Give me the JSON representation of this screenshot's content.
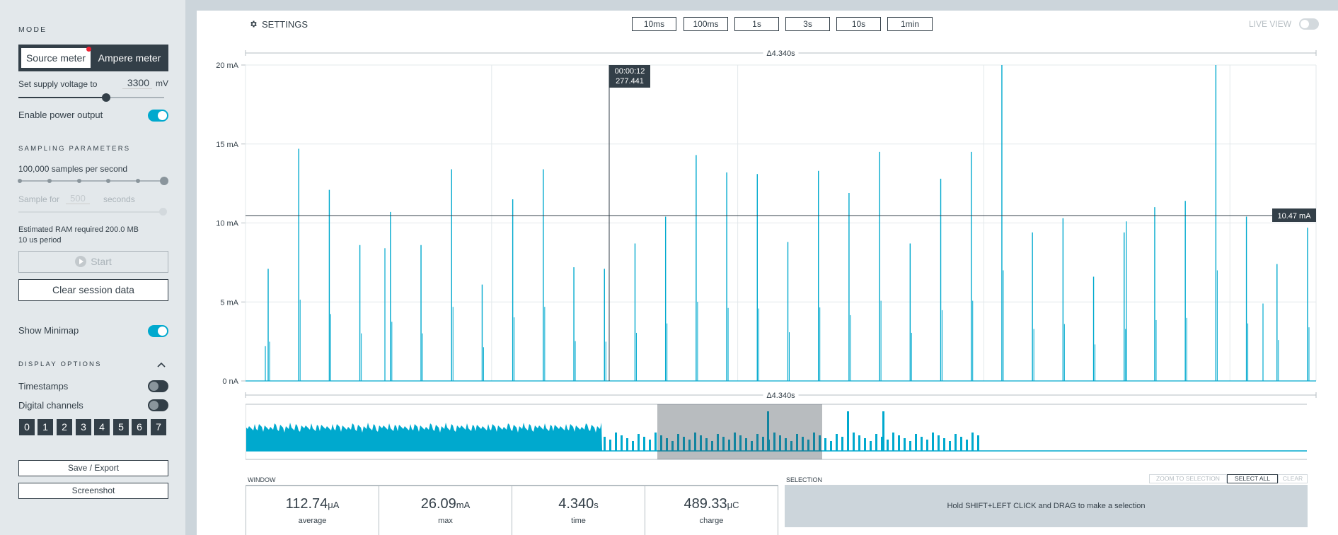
{
  "sidebar": {
    "mode_title": "MODE",
    "mode_source": "Source meter",
    "mode_ampere": "Ampere meter",
    "supply_label": "Set supply voltage to",
    "supply_value": "3300",
    "supply_unit": "mV",
    "power_label": "Enable power output",
    "sampling_title": "SAMPLING PARAMETERS",
    "samples_label": "100,000 samples per second",
    "sample_for_label": "Sample for",
    "sample_for_value": "500",
    "sample_for_unit": "seconds",
    "ram_label": "Estimated RAM required 200.0 MB",
    "period_label": "10 us period",
    "start_label": "Start",
    "clear_label": "Clear session data",
    "minimap_label": "Show Minimap",
    "display_title": "DISPLAY OPTIONS",
    "timestamps_label": "Timestamps",
    "digital_label": "Digital channels",
    "digits": [
      "0",
      "1",
      "2",
      "3",
      "4",
      "5",
      "6",
      "7"
    ],
    "save_label": "Save / Export",
    "screenshot_label": "Screenshot"
  },
  "toolbar": {
    "settings_label": "SETTINGS",
    "time_buttons": [
      "10ms",
      "100ms",
      "1s",
      "3s",
      "10s",
      "1min"
    ],
    "live_view_label": "LIVE VIEW"
  },
  "chart_data": {
    "type": "line",
    "title": "",
    "ylabel": "",
    "y_ticks": [
      "20 mA",
      "15 mA",
      "10 mA",
      "5 mA",
      "0 nA"
    ],
    "ylim": [
      0,
      20
    ],
    "window_span": "Δ4.340s",
    "cursor_time": "00:00:12",
    "cursor_value": "277.441",
    "hline_label": "10.47 mA",
    "hline_value": 10.47,
    "spikes_mA": [
      7.1,
      14.7,
      12.1,
      8.6,
      10.7,
      8.6,
      13.4,
      6.1,
      11.5,
      13.4,
      7.2,
      7.1,
      8.7,
      10.4,
      14.3,
      13.2,
      13.1,
      8.8,
      13.3,
      11.9,
      14.5,
      8.7,
      12.8,
      14.5,
      20.0,
      9.4,
      10.3,
      6.6,
      9.4,
      11.0,
      11.4,
      20.0,
      10.4,
      7.4,
      9.7
    ],
    "secondary_spikes_mA": [
      2.2,
      8.4,
      10.1,
      4.9
    ]
  },
  "minimap": {
    "label": "minimap"
  },
  "stats": {
    "window_title": "WINDOW",
    "selection_title": "SELECTION",
    "items": [
      {
        "value": "112.74",
        "unit": "μA",
        "label": "average"
      },
      {
        "value": "26.09",
        "unit": "mA",
        "label": "max"
      },
      {
        "value": "4.340",
        "unit": "s",
        "label": "time"
      },
      {
        "value": "489.33",
        "unit": "μC",
        "label": "charge"
      }
    ],
    "zoom_label": "ZOOM TO SELECTION",
    "select_all_label": "SELECT ALL",
    "clear_label": "CLEAR",
    "selection_hint": "Hold SHIFT+LEFT CLICK and DRAG to make a selection"
  }
}
